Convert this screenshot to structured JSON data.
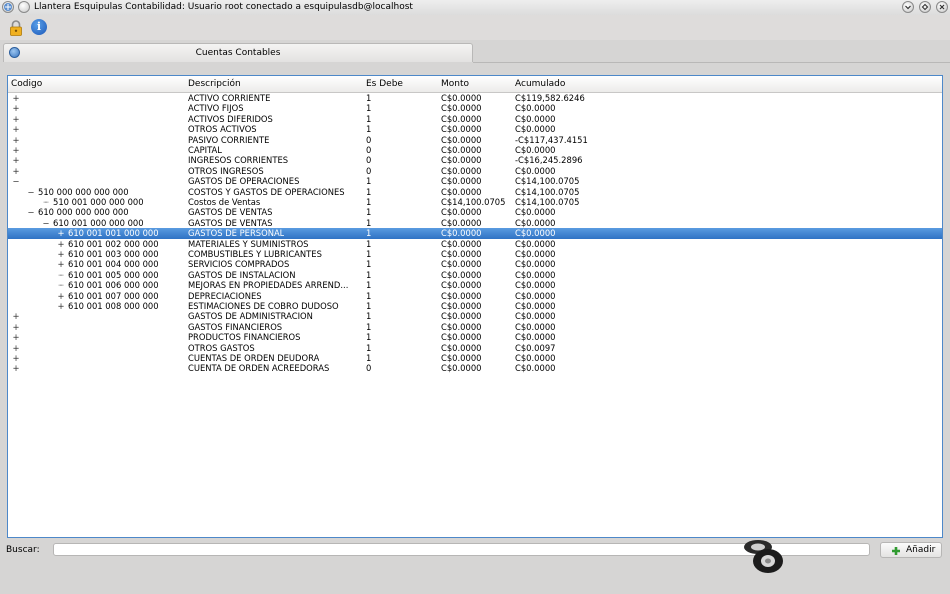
{
  "window": {
    "title": "Llantera Esquipulas Contabilidad: Usuario root conectado a esquipulasdb@localhost",
    "buttons": [
      "minimize",
      "maximize",
      "close"
    ]
  },
  "tab": {
    "label": "Cuentas Contables"
  },
  "columns": [
    "Codigo",
    "Descripción",
    "Es Debe",
    "Monto",
    "Acumulado"
  ],
  "rows": [
    {
      "exp": "+",
      "level": 0,
      "code": "",
      "desc": "ACTIVO CORRIENTE",
      "debe": "1",
      "monto": "C$0.0000",
      "acum": "C$119,582.6246"
    },
    {
      "exp": "+",
      "level": 0,
      "code": "",
      "desc": "ACTIVO FIJOS",
      "debe": "1",
      "monto": "C$0.0000",
      "acum": "C$0.0000"
    },
    {
      "exp": "+",
      "level": 0,
      "code": "",
      "desc": "ACTIVOS DIFERIDOS",
      "debe": "1",
      "monto": "C$0.0000",
      "acum": "C$0.0000"
    },
    {
      "exp": "+",
      "level": 0,
      "code": "",
      "desc": "OTROS ACTIVOS",
      "debe": "1",
      "monto": "C$0.0000",
      "acum": "C$0.0000"
    },
    {
      "exp": "+",
      "level": 0,
      "code": "",
      "desc": "PASIVO CORRIENTE",
      "debe": "0",
      "monto": "C$0.0000",
      "acum": "-C$117,437.4151"
    },
    {
      "exp": "+",
      "level": 0,
      "code": "",
      "desc": "CAPITAL",
      "debe": "0",
      "monto": "C$0.0000",
      "acum": "C$0.0000"
    },
    {
      "exp": "+",
      "level": 0,
      "code": "",
      "desc": "INGRESOS CORRIENTES",
      "debe": "0",
      "monto": "C$0.0000",
      "acum": "-C$16,245.2896"
    },
    {
      "exp": "+",
      "level": 0,
      "code": "",
      "desc": "OTROS INGRESOS",
      "debe": "0",
      "monto": "C$0.0000",
      "acum": "C$0.0000"
    },
    {
      "exp": "−",
      "level": 0,
      "code": "",
      "desc": "GASTOS DE OPERACIONES",
      "debe": "1",
      "monto": "C$0.0000",
      "acum": "C$14,100.0705"
    },
    {
      "exp": "−",
      "level": 1,
      "code": "510 000 000 000 000",
      "desc": "COSTOS Y GASTOS DE OPERACIONES",
      "debe": "1",
      "monto": "C$0.0000",
      "acum": "C$14,100.0705"
    },
    {
      "exp": "",
      "level": 2,
      "code": "510 001 000 000 000",
      "desc": "Costos de Ventas",
      "debe": "1",
      "monto": "C$14,100.0705",
      "acum": "C$14,100.0705"
    },
    {
      "exp": "−",
      "level": 1,
      "code": "610 000 000 000 000",
      "desc": "GASTOS DE VENTAS",
      "debe": "1",
      "monto": "C$0.0000",
      "acum": "C$0.0000"
    },
    {
      "exp": "−",
      "level": 2,
      "code": "610 001 000 000 000",
      "desc": "GASTOS DE VENTAS",
      "debe": "1",
      "monto": "C$0.0000",
      "acum": "C$0.0000"
    },
    {
      "exp": "+",
      "level": 3,
      "code": "610 001 001 000 000",
      "desc": "GASTOS DE PERSONAL",
      "debe": "1",
      "monto": "C$0.0000",
      "acum": "C$0.0000",
      "selected": true
    },
    {
      "exp": "+",
      "level": 3,
      "code": "610 001 002 000 000",
      "desc": "MATERIALES Y SUMINISTROS",
      "debe": "1",
      "monto": "C$0.0000",
      "acum": "C$0.0000"
    },
    {
      "exp": "+",
      "level": 3,
      "code": "610 001 003 000 000",
      "desc": "COMBUSTIBLES Y LUBRICANTES",
      "debe": "1",
      "monto": "C$0.0000",
      "acum": "C$0.0000"
    },
    {
      "exp": "+",
      "level": 3,
      "code": "610 001 004 000 000",
      "desc": "SERVICIOS COMPRADOS",
      "debe": "1",
      "monto": "C$0.0000",
      "acum": "C$0.0000"
    },
    {
      "exp": "",
      "level": 3,
      "code": "610 001 005 000 000",
      "desc": "GASTOS DE INSTALACION",
      "debe": "1",
      "monto": "C$0.0000",
      "acum": "C$0.0000"
    },
    {
      "exp": "",
      "level": 3,
      "code": "610 001 006 000 000",
      "desc": "MEJORAS EN PROPIEDADES ARREND...",
      "debe": "1",
      "monto": "C$0.0000",
      "acum": "C$0.0000"
    },
    {
      "exp": "+",
      "level": 3,
      "code": "610 001 007 000 000",
      "desc": "DEPRECIACIONES",
      "debe": "1",
      "monto": "C$0.0000",
      "acum": "C$0.0000"
    },
    {
      "exp": "+",
      "level": 3,
      "code": "610 001 008 000 000",
      "desc": "ESTIMACIONES DE COBRO DUDOSO",
      "debe": "1",
      "monto": "C$0.0000",
      "acum": "C$0.0000"
    },
    {
      "exp": "+",
      "level": 0,
      "code": "",
      "desc": "GASTOS DE ADMINISTRACION",
      "debe": "1",
      "monto": "C$0.0000",
      "acum": "C$0.0000"
    },
    {
      "exp": "+",
      "level": 0,
      "code": "",
      "desc": "GASTOS FINANCIEROS",
      "debe": "1",
      "monto": "C$0.0000",
      "acum": "C$0.0000"
    },
    {
      "exp": "+",
      "level": 0,
      "code": "",
      "desc": "PRODUCTOS FINANCIEROS",
      "debe": "1",
      "monto": "C$0.0000",
      "acum": "C$0.0000"
    },
    {
      "exp": "+",
      "level": 0,
      "code": "",
      "desc": "OTROS GASTOS",
      "debe": "1",
      "monto": "C$0.0000",
      "acum": "C$0.0097"
    },
    {
      "exp": "+",
      "level": 0,
      "code": "",
      "desc": "CUENTAS DE ORDEN DEUDORA",
      "debe": "1",
      "monto": "C$0.0000",
      "acum": "C$0.0000"
    },
    {
      "exp": "+",
      "level": 0,
      "code": "",
      "desc": "CUENTA DE ORDEN ACREEDORAS",
      "debe": "0",
      "monto": "C$0.0000",
      "acum": "C$0.0000"
    }
  ],
  "search": {
    "label": "Buscar:",
    "value": ""
  },
  "add_button": {
    "label": "Añadir"
  },
  "icons": {
    "toolbar": [
      "lock-icon",
      "info-icon"
    ],
    "tab": "globe-icon",
    "button": "plus-icon"
  },
  "colors": {
    "selection": "#3d80cf",
    "frame": "#4d88c9"
  }
}
